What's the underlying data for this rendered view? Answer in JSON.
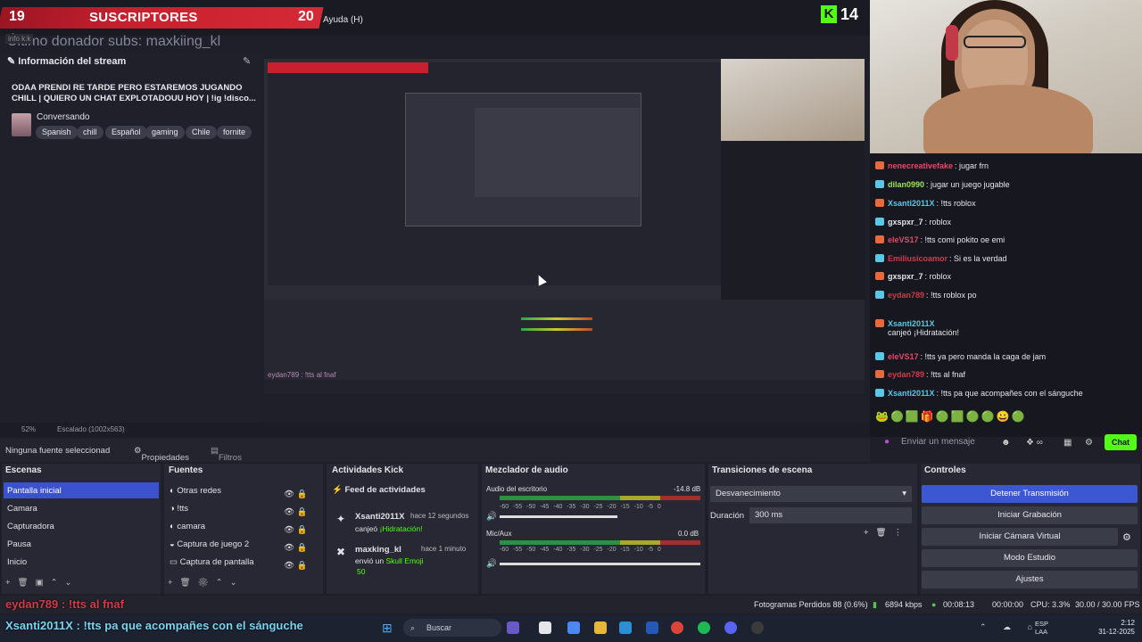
{
  "overlay": {
    "subs_count": "19",
    "subs_label": "SUSCRIPTORES",
    "subs_goal": "20",
    "menu_help": "Ayuda (H)",
    "kick_count": "14",
    "last_donor": "Último donador subs: maxkiing_kl",
    "info_k": "info k:k"
  },
  "stream_info": {
    "header": "Información del stream",
    "title": "ODAA PRENDI RE TARDE PERO ESTAREMOS JUGANDO CHILL | QUIERO UN CHAT EXPLOTADOUU HOY | !ig !disco...",
    "category": "Conversando",
    "tags": [
      "Spanish",
      "chill",
      "Español",
      "gaming",
      "Chile",
      "fornite"
    ]
  },
  "preview_overlay_chat": "eydan789 : !tts al fnaf",
  "zoom": {
    "percent": "52%",
    "scale": "Escalado (1002x563)"
  },
  "chat": {
    "messages": [
      {
        "user": "nenecreativefake",
        "text": ": jugar frn",
        "color": "#e14b6a"
      },
      {
        "user": "dilan0990",
        "text": ": jugar un juego jugable",
        "color": "#9be35a"
      },
      {
        "user": "Xsanti2011X",
        "text": ": !tts roblox",
        "color": "#59c7e8"
      },
      {
        "user": "gxspxr_7",
        "text": ": roblox",
        "color": "#e6e6ea"
      },
      {
        "user": "eleVS17",
        "text": ": !tts comi pokito oe emi",
        "color": "#e14b6a"
      },
      {
        "user": "Emiliusicoamor",
        "text": ": Si es la verdad",
        "color": "#d03b4a"
      },
      {
        "user": "gxspxr_7",
        "text": ": roblox",
        "color": "#e6e6ea"
      },
      {
        "user": "eydan789",
        "text": ": !tts roblox po",
        "color": "#d03b4a"
      },
      {
        "user": "Xsanti2011X",
        "text": "canjeó ¡Hidratación!",
        "color": "#59c7e8"
      },
      {
        "user": "eleVS17",
        "text": ": !tts ya pero manda la caga de jam",
        "color": "#e14b6a"
      },
      {
        "user": "eydan789",
        "text": ": !tts al fnaf",
        "color": "#d03b4a"
      },
      {
        "user": "Xsanti2011X",
        "text": ": !tts pa que acompañes con el sánguche",
        "color": "#59c7e8"
      }
    ],
    "input_placeholder": "Enviar un mensaje",
    "send_label": "Chat"
  },
  "source_bar": {
    "no_source": "Ninguna fuente seleccionad",
    "properties": "Propiedades",
    "filters": "Filtros"
  },
  "scenes": {
    "title": "Escenas",
    "items": [
      "Pantalla inicial",
      "Camara",
      "Capturadora",
      "Pausa",
      "Inicio"
    ]
  },
  "sources": {
    "title": "Fuentes",
    "items": [
      "Otras redes",
      "!tts",
      "camara",
      "Captura de juego 2",
      "Captura de pantalla"
    ]
  },
  "kick": {
    "title": "Actividades Kick",
    "feed": "Feed de actividades",
    "events": [
      {
        "user": "Xsanti2011X",
        "time": "hace 12 segundos",
        "action": "canjeó",
        "reward": "¡Hidratación!"
      },
      {
        "user": "maxking_kl",
        "time": "hace 1 minuto",
        "action": "envió un",
        "reward": "Skull Emoji",
        "amount": "50"
      }
    ]
  },
  "mixer": {
    "title": "Mezclador de audio",
    "channels": [
      {
        "name": "Audio del escritorio",
        "db": "-14.8 dB",
        "level": 0.62
      },
      {
        "name": "Mic/Aux",
        "db": "0.0 dB",
        "level": 0.58
      }
    ],
    "ticks": [
      "-60",
      "-55",
      "-50",
      "-45",
      "-40",
      "-35",
      "-30",
      "-25",
      "-20",
      "-15",
      "-10",
      "-5",
      "0"
    ]
  },
  "transitions": {
    "title": "Transiciones de escena",
    "selected": "Desvanecimiento",
    "duration_label": "Duración",
    "duration_value": "300 ms"
  },
  "controls": {
    "title": "Controles",
    "buttons": [
      "Detener Transmisión",
      "Iniciar Grabación",
      "Iniciar Cámara Virtual",
      "Modo Estudio",
      "Ajustes"
    ]
  },
  "status": {
    "dropped": "Fotogramas Perdidos 88 (0.6%)",
    "bitrate": "6894 kbps",
    "time1": "00:08:13",
    "time2": "00:00:00",
    "cpu": "CPU: 3.3%",
    "fps": "30.00 / 30.00 FPS"
  },
  "overlay_bottom": {
    "line1": "eydan789 : !tts al fnaf",
    "line2": "Xsanti2011X : !tts pa que acompañes con el sánguche"
  },
  "taskbar": {
    "search": "Buscar",
    "lang1": "ESP",
    "lang2": "LAA",
    "time": "2:12",
    "date": "31-12-2025"
  },
  "colors": {
    "accent": "#3c57d2",
    "kick_green": "#53fc18",
    "sub_red": "#c8202e"
  }
}
